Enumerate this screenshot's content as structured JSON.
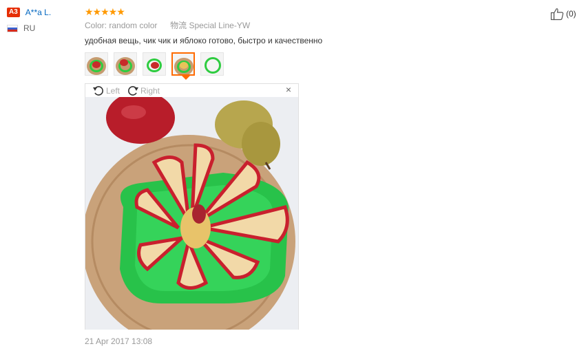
{
  "user": {
    "level": "A3",
    "name": "A**a L.",
    "country": "RU"
  },
  "review": {
    "rating": 5,
    "stars": "★★★★★",
    "color_label": "Color:",
    "color_value": "random color",
    "shipping_label": "物流",
    "shipping_value": "Special Line-YW",
    "text": "удобная вещь, чик чик и яблоко готово, быстро и качественно",
    "date": "21 Apr 2017 13:08"
  },
  "viewer": {
    "rotate_left": "Left",
    "rotate_right": "Right",
    "close": "×",
    "active_thumb_index": 4,
    "thumb_count": 5
  },
  "helpful": {
    "count": "(0)"
  },
  "colors": {
    "accent": "#ff6a00",
    "star": "#ff9900",
    "link": "#0066c0",
    "badge": "#e62e04"
  }
}
